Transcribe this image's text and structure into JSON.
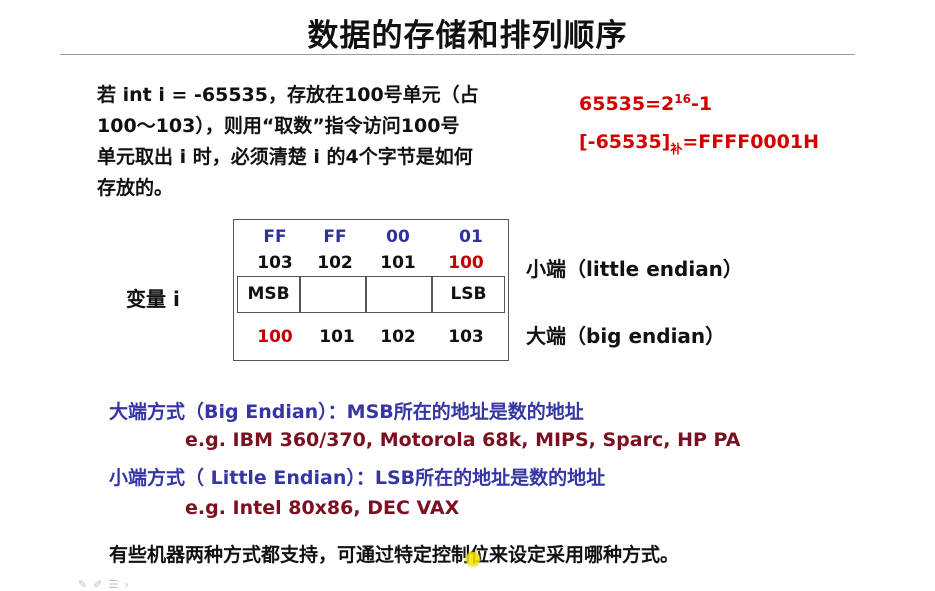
{
  "title": "数据的存储和排列顺序",
  "intro": {
    "line1": "若 int i = -65535，存放在100号单元（占",
    "line2": "100～103），则用“取数”指令访问100号",
    "line3": "单元取出 i 时，必须清楚 i 的4个字节是如何",
    "line4": "存放的。"
  },
  "formulas": {
    "f1_base": "65535=2",
    "f1_exp": "16",
    "f1_tail": "-1",
    "f2_bracket": "[-65535]",
    "f2_sub": "补",
    "f2_tail": "=FFFF0001H"
  },
  "table": {
    "hex_bytes": [
      "FF",
      "FF",
      "00",
      "01"
    ],
    "little_addresses": [
      "103",
      "102",
      "101",
      "100"
    ],
    "byte_row": [
      "MSB",
      "",
      "",
      "LSB"
    ],
    "big_addresses": [
      "100",
      "101",
      "102",
      "103"
    ]
  },
  "variable_label": "变量 i",
  "little_endian_label": "小端（little endian）",
  "big_endian_label": "大端（big endian）",
  "big_endian_desc": "大端方式（Big Endian）：MSB所在的地址是数的地址",
  "big_endian_eg": "e.g. IBM 360/370, Motorola 68k, MIPS, Sparc, HP PA",
  "little_endian_desc": "小端方式（ Little Endian）：LSB所在的地址是数的地址",
  "little_endian_eg": "e.g. Intel 80x86, DEC VAX",
  "bottom_note": "有些机器两种方式都支持，可通过特定控制位来设定采用哪种方式。",
  "colors": {
    "red": "#d40000",
    "blue": "#3535a5",
    "maroon": "#7a1020"
  }
}
